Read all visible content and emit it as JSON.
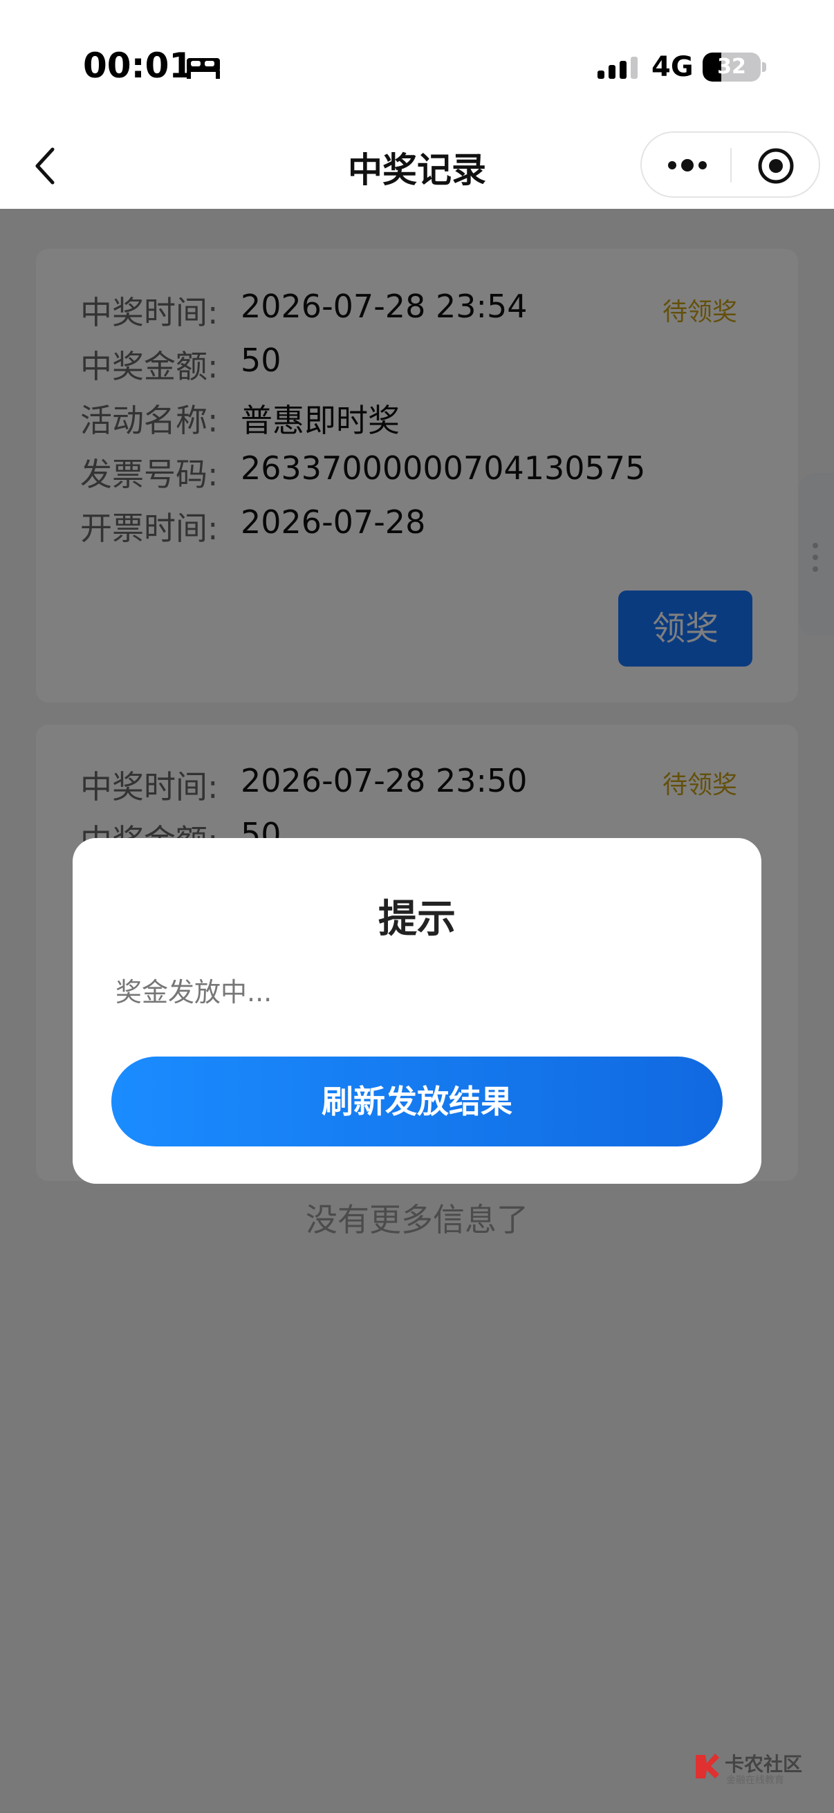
{
  "status_bar": {
    "time": "00:01",
    "network": "4G",
    "battery": "32",
    "battery_level": 0.32
  },
  "nav": {
    "title": "中奖记录"
  },
  "records": [
    {
      "status": "待领奖",
      "fields": [
        {
          "label": "中奖时间:",
          "value": "2026-07-28 23:54"
        },
        {
          "label": "中奖金额:",
          "value": "50"
        },
        {
          "label": "活动名称:",
          "value": "普惠即时奖"
        },
        {
          "label": "发票号码:",
          "value": "26337000000704130575"
        },
        {
          "label": "开票时间:",
          "value": "2026-07-28"
        }
      ],
      "button": "领奖"
    },
    {
      "status": "待领奖",
      "fields": [
        {
          "label": "中奖时间:",
          "value": "2026-07-28 23:50"
        },
        {
          "label": "中奖金额:",
          "value": "50"
        }
      ]
    }
  ],
  "footer_text": "没有更多信息了",
  "dialog": {
    "title": "提示",
    "message": "奖金发放中...",
    "button": "刷新发放结果"
  },
  "watermark": {
    "text": "卡农社区",
    "sub": "金融在线教育"
  },
  "colors": {
    "accent": "#1677ff",
    "status_pending": "#c9a018",
    "mask": "rgba(0,0,0,0.50)"
  }
}
